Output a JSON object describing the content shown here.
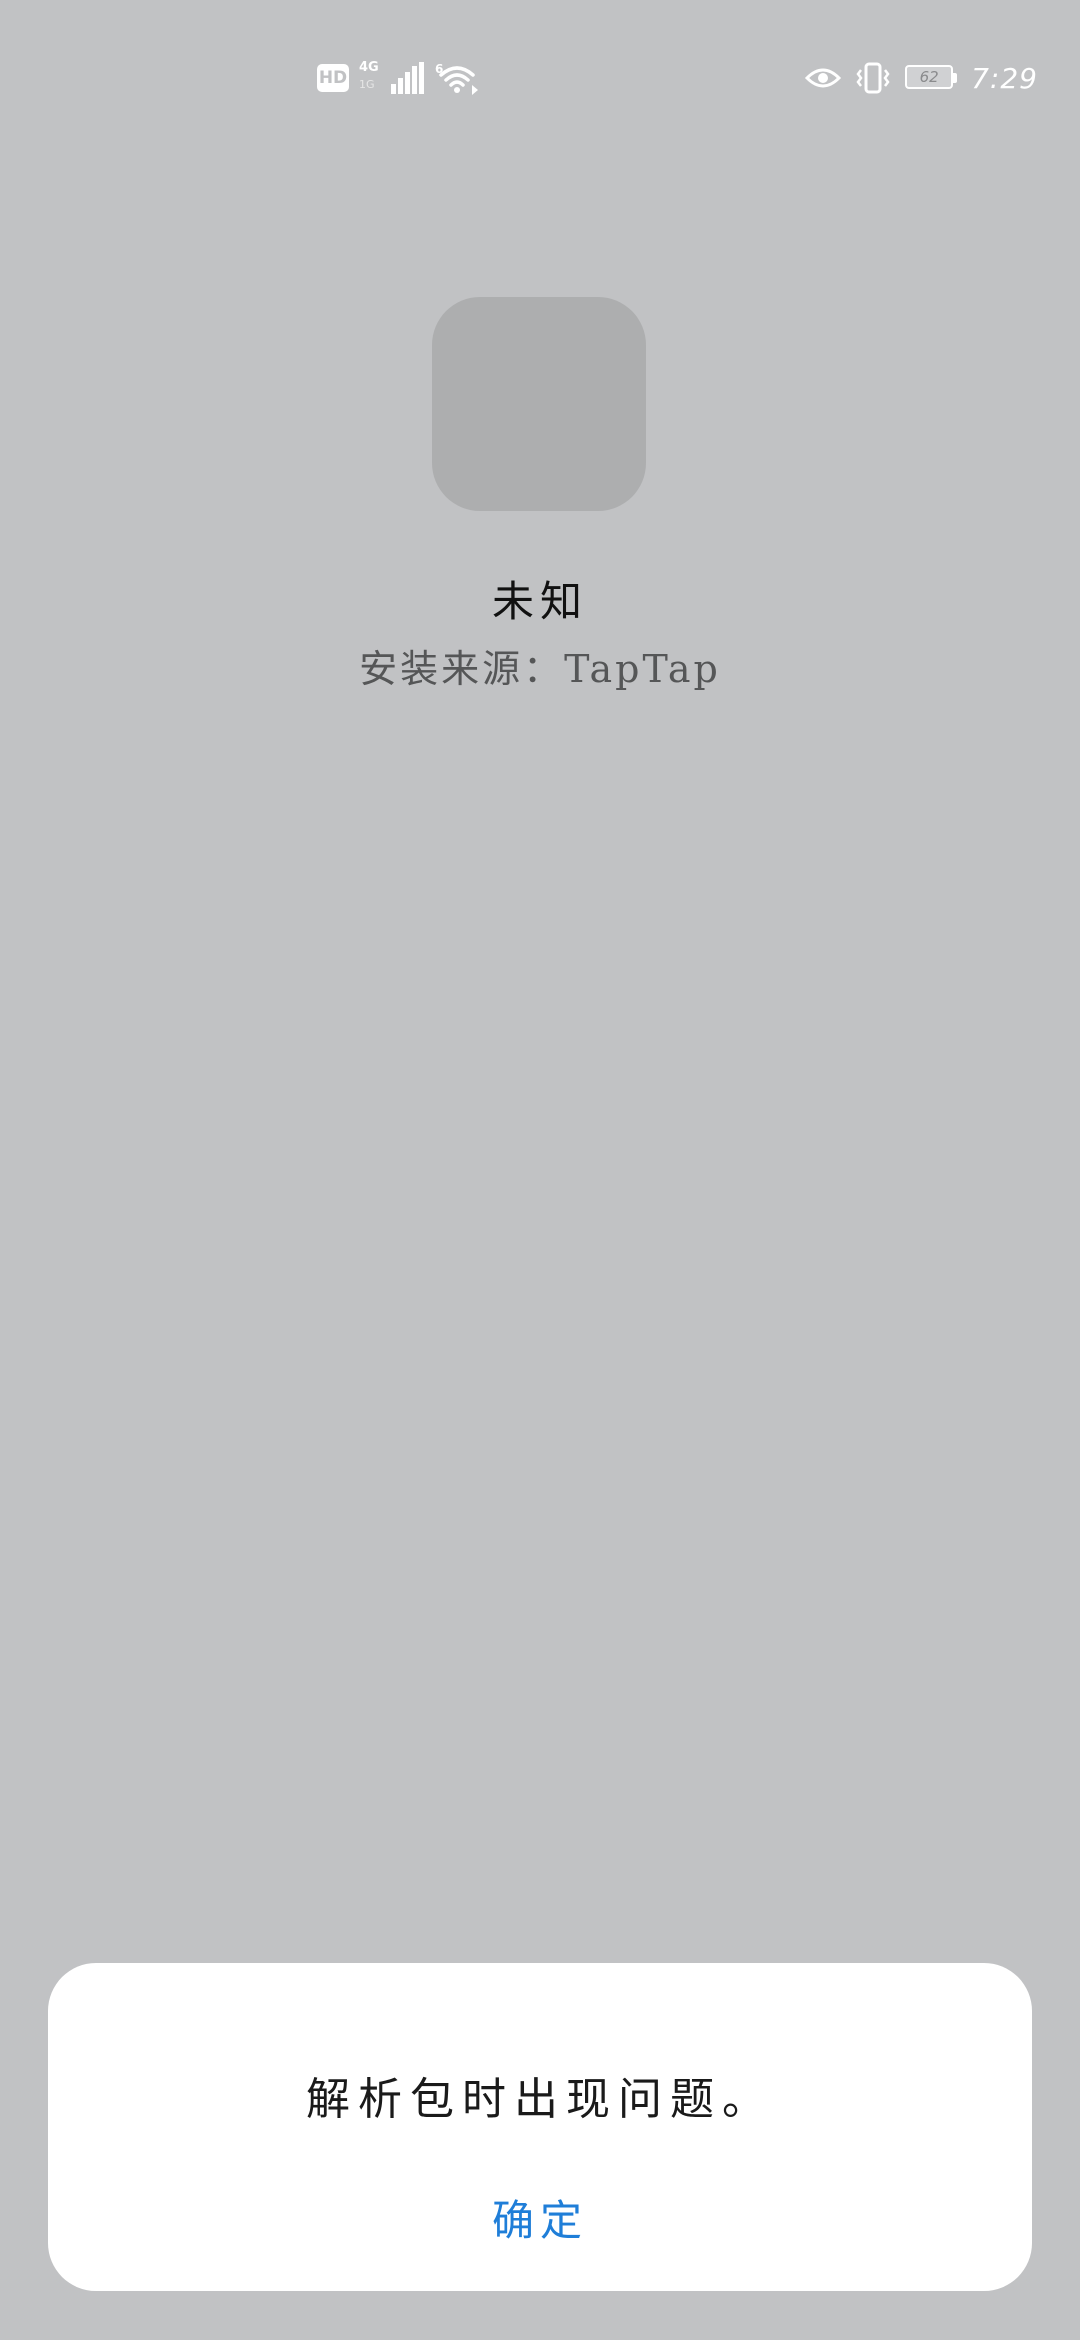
{
  "status_bar": {
    "hd_label": "HD",
    "network_type": "4G",
    "network_sub": "1G",
    "wifi_badge": "6",
    "battery_level": "62",
    "time": "7:29"
  },
  "app": {
    "name": "未知",
    "install_source": "安装来源：TapTap"
  },
  "dialog": {
    "message": "解析包时出现问题。",
    "confirm_label": "确定"
  },
  "colors": {
    "background": "#c1c2c4",
    "accent": "#1f7ed8"
  }
}
